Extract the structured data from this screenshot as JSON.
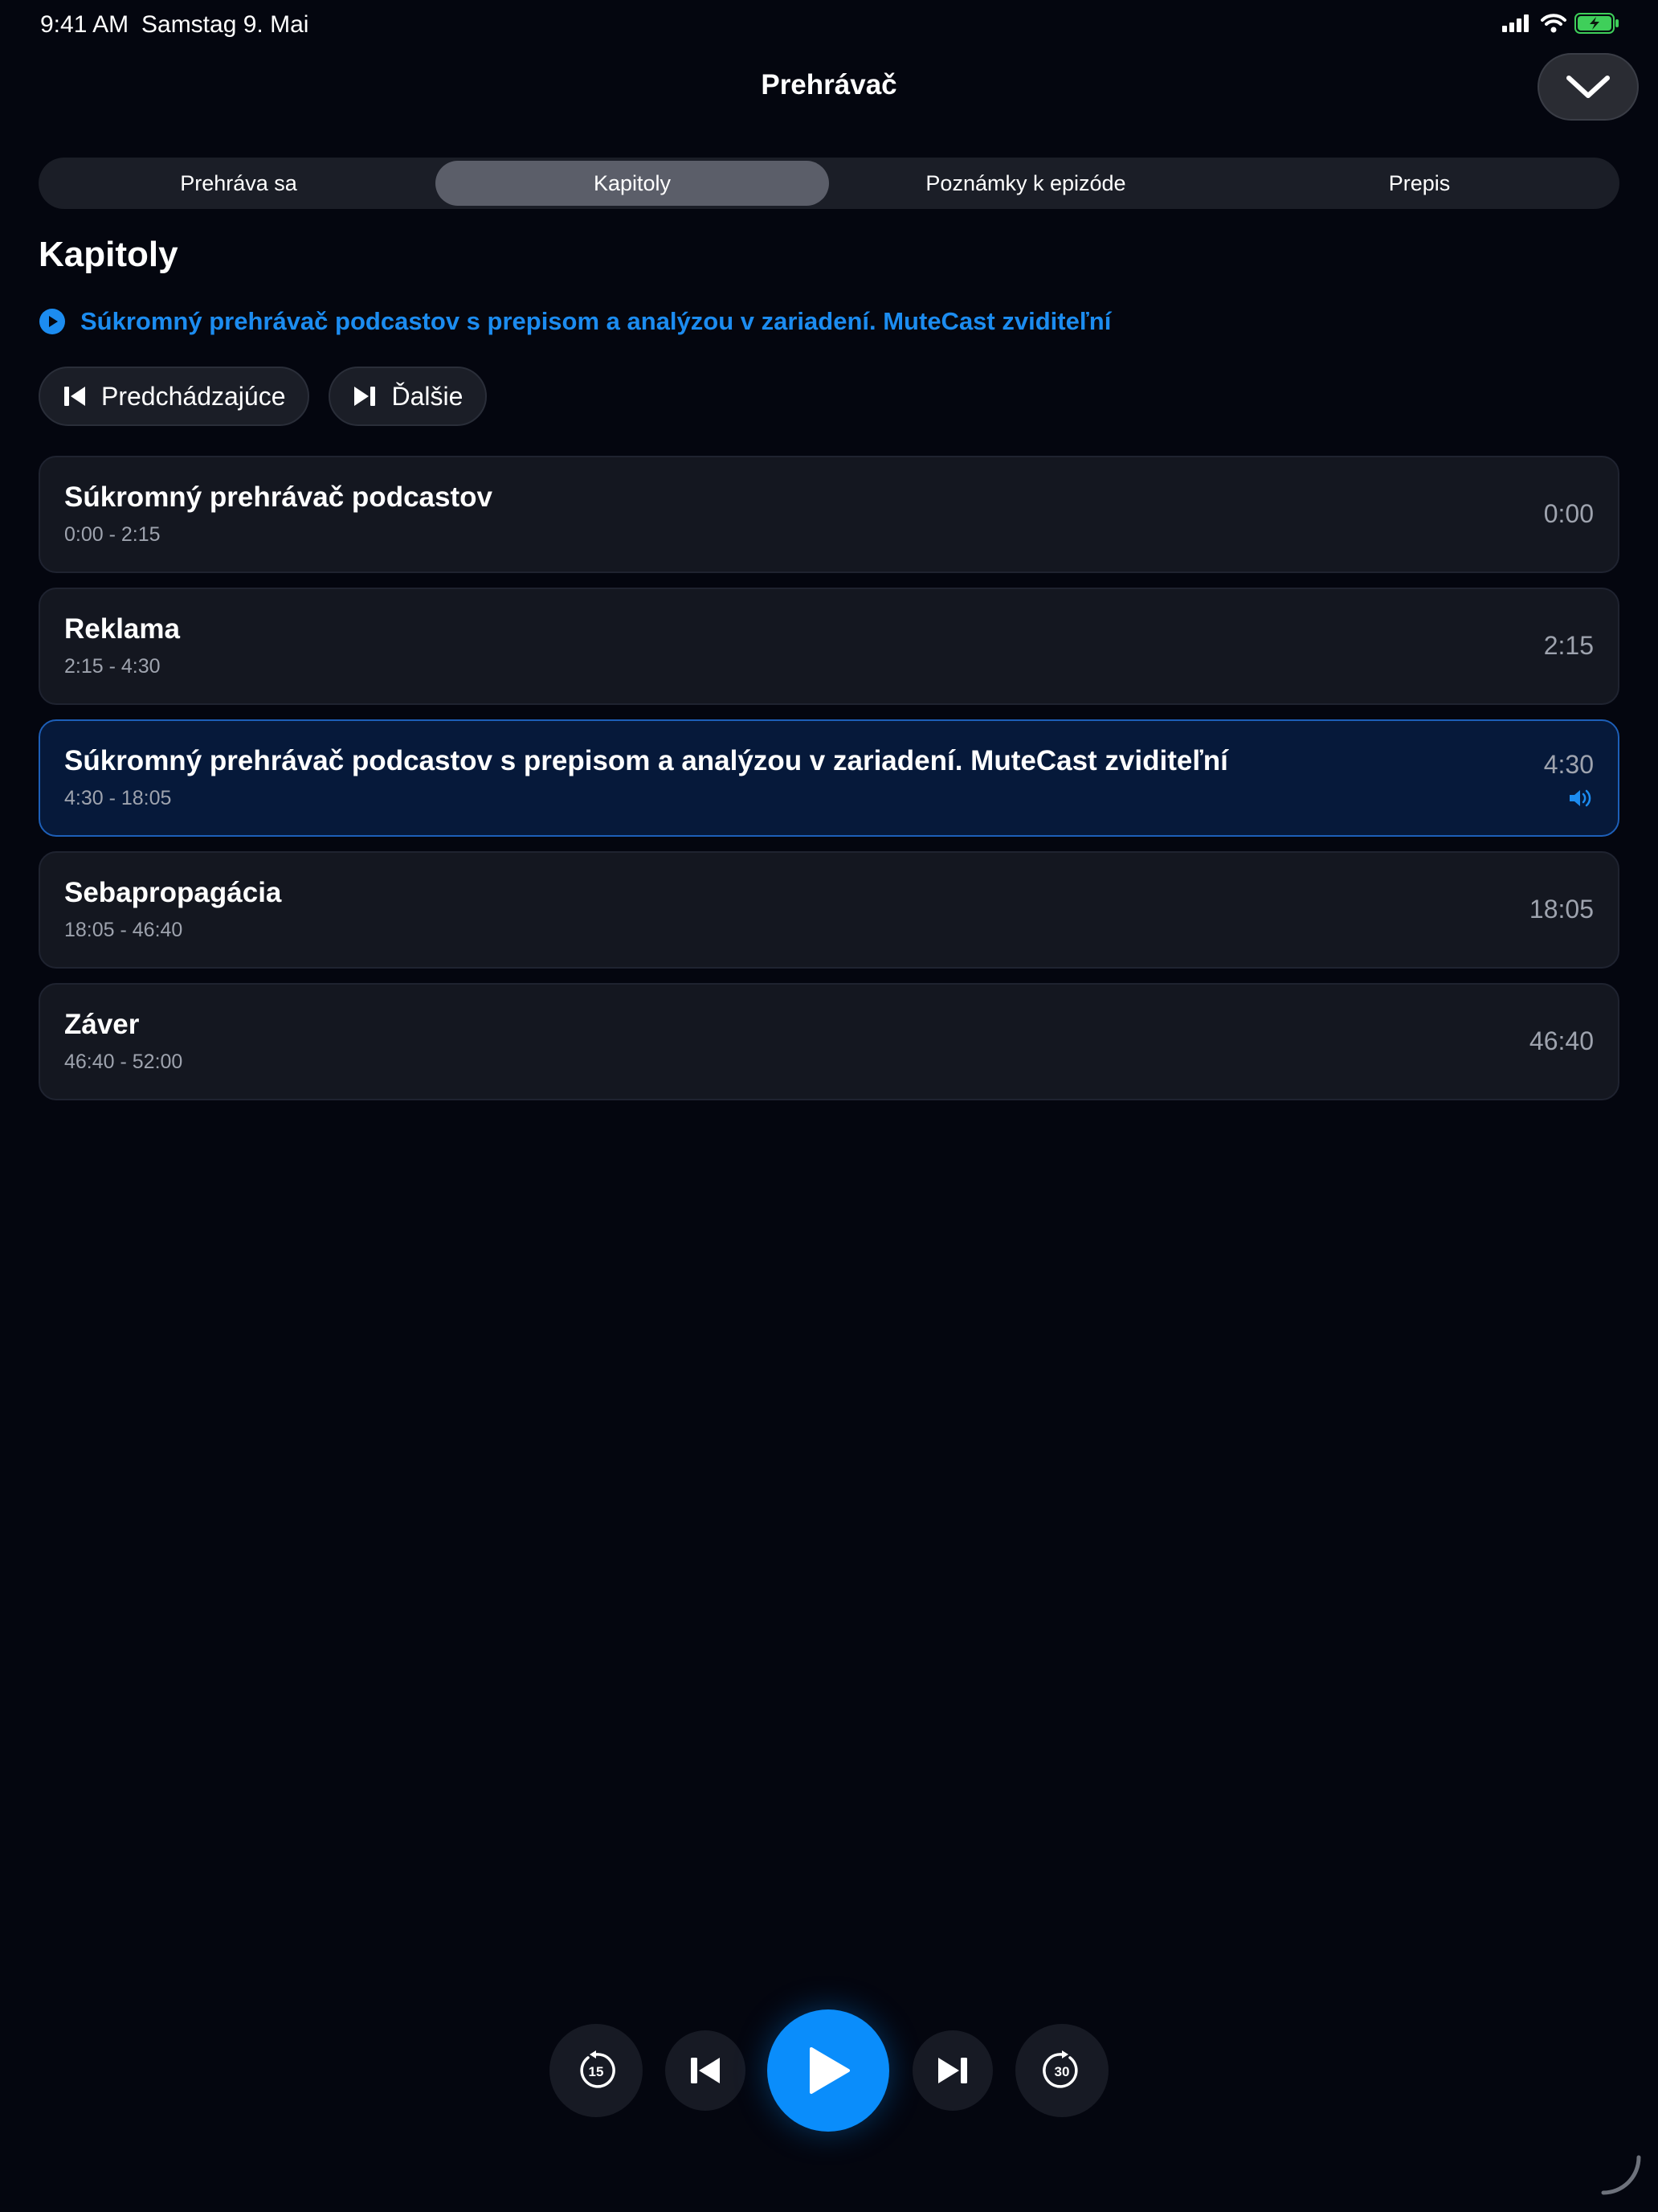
{
  "status_bar": {
    "time": "9:41 AM",
    "date": "Samstag 9. Mai"
  },
  "header": {
    "title": "Prehrávač"
  },
  "tabs": [
    {
      "label": "Prehráva sa",
      "active": false
    },
    {
      "label": "Kapitoly",
      "active": true
    },
    {
      "label": "Poznámky k epizóde",
      "active": false
    },
    {
      "label": "Prepis",
      "active": false
    }
  ],
  "section": {
    "title": "Kapitoly"
  },
  "now_playing_chapter": "Súkromný prehrávač podcastov s prepisom a analýzou v zariadení. MuteCast zviditeľní",
  "nav_buttons": {
    "previous": "Predchádzajúce",
    "next": "Ďalšie"
  },
  "chapters": [
    {
      "title": "Súkromný prehrávač podcastov",
      "range": "0:00 - 2:15",
      "start": "0:00",
      "current": false
    },
    {
      "title": "Reklama",
      "range": "2:15 - 4:30",
      "start": "2:15",
      "current": false
    },
    {
      "title": "Súkromný prehrávač podcastov s prepisom a analýzou v zariadení. MuteCast zviditeľní",
      "range": "4:30 - 18:05",
      "start": "4:30",
      "current": true
    },
    {
      "title": "Sebapropagácia",
      "range": "18:05 - 46:40",
      "start": "18:05",
      "current": false
    },
    {
      "title": "Záver",
      "range": "46:40 - 52:00",
      "start": "46:40",
      "current": false
    }
  ],
  "controls": {
    "skip_back_seconds": "15",
    "skip_forward_seconds": "30"
  },
  "colors": {
    "accent": "#0a8dfb",
    "background": "#04060f",
    "card": "#141720",
    "current_card": "#06193a"
  }
}
